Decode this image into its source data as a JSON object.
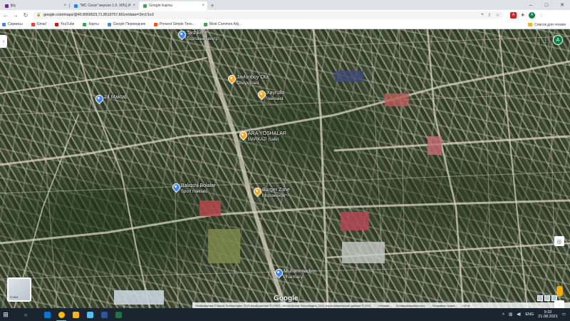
{
  "browser": {
    "tabs": [
      {
        "label": "ljtq",
        "favicon_color": "#7b1fa2",
        "active": false
      },
      {
        "label": "\"МС Сели\" версия 1.0. ИЛЦ Ин",
        "favicon_color": "#1e88e5",
        "active": false
      },
      {
        "label": "Google Карты",
        "favicon_color": "#34a853",
        "active": true
      }
    ],
    "new_tab": "+",
    "url": "google.com/maps/@40.8959523,71.8519757,661m/data=!3m1!1e3",
    "bookmarks": [
      {
        "label": "Сервисы",
        "color": "#4285f4"
      },
      {
        "label": "Gmail",
        "color": "#ea4335"
      },
      {
        "label": "YouTube",
        "color": "#ff0000"
      },
      {
        "label": "Карты",
        "color": "#34a853"
      },
      {
        "label": "Google Переводчик",
        "color": "#4285f4"
      },
      {
        "label": "Present Simple Tens...",
        "color": "#f4511e"
      },
      {
        "label": "Most Common Adj...",
        "color": "#43a047"
      }
    ],
    "other_bookmarks": "Список для чтения",
    "profile_initial": "A",
    "extension_label": "A"
  },
  "map": {
    "places": [
      {
        "name": "Tashkent",
        "sub": "Торговый центр",
        "pin": "blue"
      },
      {
        "name": "24 Maktab",
        "sub": "",
        "pin": "blue"
      },
      {
        "name": "Javlonboy Ota",
        "sub": "Choyxonasi",
        "pin": "orange"
      },
      {
        "name": "Xayrullo",
        "sub": "Чайхана",
        "pin": "orange"
      },
      {
        "name": "ARA YOSHALAR",
        "sub": "MARKAZI (cafe)",
        "pin": "orange"
      },
      {
        "name": "Burger Zone",
        "sub": "Мороженое",
        "pin": "orange"
      },
      {
        "name": "Baliqchi Bolalar",
        "sub": "Sport maktabi",
        "pin": "blue"
      },
      {
        "name": "Muhammadjon",
        "sub": "Pharmacy",
        "pin": "blue"
      }
    ],
    "layer_label": "Слои",
    "logo": "Google",
    "attribution": [
      "Изображения © Maxar Technologies, 2021 Изображения © CNES / Airbus Maxar Technologies, 2021 Картографические данные © 2021",
      "Условия",
      "Конфиденциальность",
      "Отправить отзыв",
      "100 м"
    ],
    "account_initial": "A"
  },
  "taskbar": {
    "apps": [
      {
        "name": "edge",
        "color": "#0078d7"
      },
      {
        "name": "chrome",
        "color": "#fbbc05"
      },
      {
        "name": "explorer",
        "color": "#f2b51b"
      },
      {
        "name": "mail",
        "color": "#4fc3f7"
      },
      {
        "name": "word",
        "color": "#2b579a"
      },
      {
        "name": "excel",
        "color": "#217346"
      }
    ],
    "lang": "ENG",
    "time": "9:32",
    "date": "21.08.2021"
  }
}
